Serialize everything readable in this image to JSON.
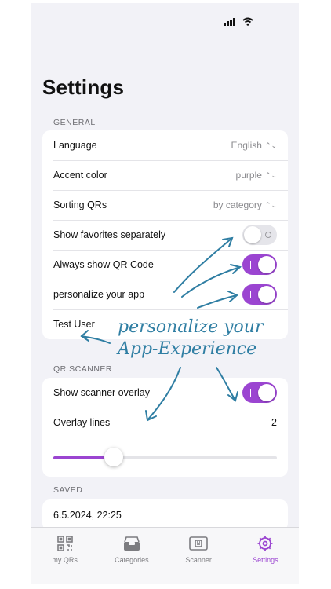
{
  "page": {
    "title": "Settings"
  },
  "general": {
    "label": "GENERAL",
    "language": {
      "label": "Language",
      "value": "English"
    },
    "accent": {
      "label": "Accent color",
      "value": "purple"
    },
    "sorting": {
      "label": "Sorting QRs",
      "value": "by category"
    },
    "favorites": {
      "label": "Show favorites separately",
      "on": false
    },
    "always_qr": {
      "label": "Always show QR Code",
      "on": true
    },
    "personalize": {
      "label": "personalize your app",
      "on": true
    },
    "user": {
      "label": "Test User"
    }
  },
  "scanner": {
    "label": "QR SCANNER",
    "overlay": {
      "label": "Show scanner overlay",
      "on": true
    },
    "lines": {
      "label": "Overlay lines",
      "value": "2",
      "fraction": 0.27
    }
  },
  "saved": {
    "label": "SAVED",
    "entry": "6.5.2024, 22:25"
  },
  "tabs": [
    {
      "label": "my QRs",
      "icon": "qr-code-icon"
    },
    {
      "label": "Categories",
      "icon": "tray-icon"
    },
    {
      "label": "Scanner",
      "icon": "scan-frame-icon"
    },
    {
      "label": "Settings",
      "icon": "gear-icon",
      "active": true
    }
  ],
  "annotation": {
    "line1": "personalize your",
    "line2": "App-Experience"
  },
  "colors": {
    "accent": "#9b45d1",
    "annotation": "#2f7ea3",
    "background": "#f2f2f7"
  }
}
